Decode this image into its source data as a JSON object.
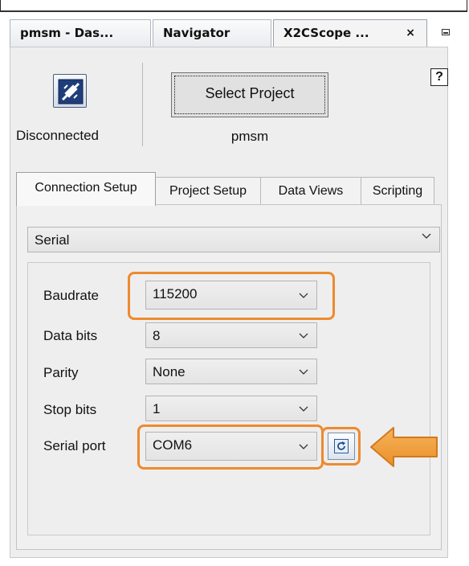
{
  "window_tabs": [
    {
      "label": "pmsm - Das..."
    },
    {
      "label": "Navigator"
    },
    {
      "label": "X2CScope ..."
    }
  ],
  "close_glyph": "×",
  "minimize_icon": "minimize-icon",
  "connection": {
    "status_label": "Disconnected",
    "icon": "disconnected-plug-icon"
  },
  "project": {
    "select_button": "Select Project",
    "name": "pmsm"
  },
  "help_label": "?",
  "inner_tabs": [
    {
      "label": "Connection Setup",
      "active": true
    },
    {
      "label": "Project Setup"
    },
    {
      "label": "Data Views"
    },
    {
      "label": "Scripting"
    }
  ],
  "connection_type": {
    "value": "Serial"
  },
  "fields": {
    "baudrate": {
      "label": "Baudrate",
      "value": "115200"
    },
    "databits": {
      "label": "Data bits",
      "value": "8"
    },
    "parity": {
      "label": "Parity",
      "value": "None"
    },
    "stopbits": {
      "label": "Stop bits",
      "value": "1"
    },
    "serialport": {
      "label": "Serial port",
      "value": "COM6"
    }
  },
  "colors": {
    "highlight": "#ee8a2f",
    "arrow": "#f0a040",
    "panel_bg": "#eeeeee"
  },
  "refresh_icon": "refresh-icon"
}
